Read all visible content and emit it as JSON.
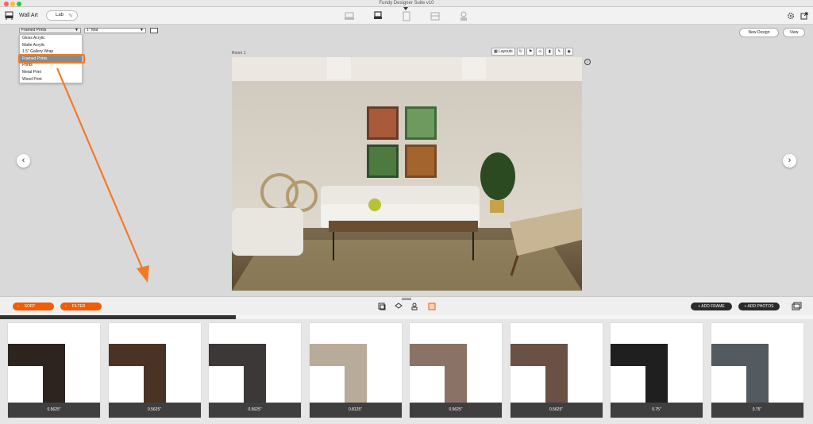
{
  "window": {
    "title": "Fundy Designer Suite v10"
  },
  "toolbar": {
    "section_label": "Wall Art",
    "lab_label": "Lab"
  },
  "product_select": {
    "selected": "Framed Prints",
    "options": [
      "Gloss Acrylic",
      "Matte Acrylic",
      "1.5\" Gallery Wrap",
      "Framed Prints",
      "Prints",
      "Metal Print",
      "Wood Print"
    ]
  },
  "mat_select": {
    "selected": "1\" Mat"
  },
  "top_buttons": {
    "new_design": "New Design",
    "view": "View"
  },
  "room": {
    "label": "Room 1",
    "layouts_label": "Layouts"
  },
  "controls": {
    "sort_label": "SORT",
    "filter_label": "FILTER",
    "add_frame_label": "+ ADD FRAME",
    "add_photos_label": "+ ADD PHOTOS"
  },
  "progress": {
    "value": 0.29
  },
  "frames": [
    {
      "label": "0.5625\"",
      "color": "#2d2420"
    },
    {
      "label": "0.5625\"",
      "color": "#4a3325"
    },
    {
      "label": "0.5625\"",
      "color": "#3d3838"
    },
    {
      "label": "0.8125\"",
      "color": "#b8ab9a"
    },
    {
      "label": "0.5625\"",
      "color": "#8a7366"
    },
    {
      "label": "0.5625\"",
      "color": "#6b5045"
    },
    {
      "label": "0.75\"",
      "color": "#1f1f1f"
    },
    {
      "label": "0.75\"",
      "color": "#545b60"
    }
  ],
  "colors": {
    "accent": "#f25c05",
    "highlight": "#f07a2a"
  }
}
